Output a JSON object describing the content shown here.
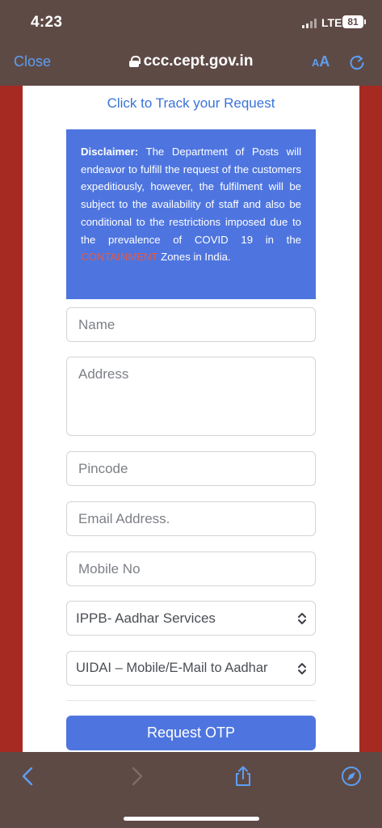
{
  "status": {
    "time": "4:23",
    "network": "LTE",
    "battery": "81"
  },
  "browser": {
    "close_label": "Close",
    "url": "ccc.cept.gov.in",
    "text_size_small": "A",
    "text_size_large": "A"
  },
  "page": {
    "track_link": "Click to Track your Request",
    "disclaimer": {
      "label": "Disclaimer:",
      "text_before": " The Department of Posts will endeavor to fulfill the request of the customers expeditiously, however, the fulfilment will be subject to the availability of staff and also be conditional to the restrictions imposed due to the prevalence of COVID 19 in the ",
      "highlight": "CONTAINMENT",
      "text_after": " Zones in India."
    },
    "form": {
      "name_placeholder": "Name",
      "address_placeholder": "Address",
      "pincode_placeholder": "Pincode",
      "email_placeholder": "Email Address.",
      "mobile_placeholder": "Mobile No",
      "service_select": "IPPB- Aadhar Services",
      "subservice_select": "UIDAI – Mobile/E-Mail to Aadhar",
      "submit_label": "Request OTP"
    }
  },
  "colors": {
    "accent": "#4e75df",
    "link": "#3a73d9",
    "highlight": "#e45a48",
    "chrome": "#5e4a45",
    "backdrop": "#a72a22"
  }
}
